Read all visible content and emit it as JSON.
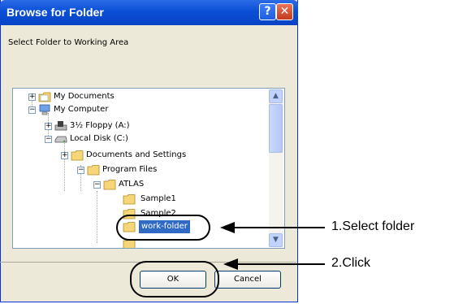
{
  "dialog": {
    "title": "Browse for Folder",
    "help_glyph": "?",
    "close_glyph": "✕",
    "instruction": "Select Folder to Working Area"
  },
  "tree": {
    "items": [
      {
        "label": "My Documents",
        "expander": "+"
      },
      {
        "label": "My Computer",
        "expander": "−"
      },
      {
        "label": "3½ Floppy (A:)",
        "expander": "+"
      },
      {
        "label": "Local Disk (C:)",
        "expander": "−"
      },
      {
        "label": "Documents and Settings",
        "expander": "+"
      },
      {
        "label": "Program Files",
        "expander": "−"
      },
      {
        "label": "ATLAS",
        "expander": "−"
      },
      {
        "label": "Sample1",
        "expander": ""
      },
      {
        "label": "Sample2",
        "expander": ""
      },
      {
        "label": "work-folder",
        "expander": "",
        "selected": true
      }
    ]
  },
  "buttons": {
    "ok": "OK",
    "cancel": "Cancel"
  },
  "callouts": {
    "select_folder": "1.Select folder",
    "click": "2.Click"
  },
  "colors": {
    "titlebar": "#0a4fd6",
    "selection": "#316ac5",
    "dialog_bg": "#ece9d8"
  }
}
